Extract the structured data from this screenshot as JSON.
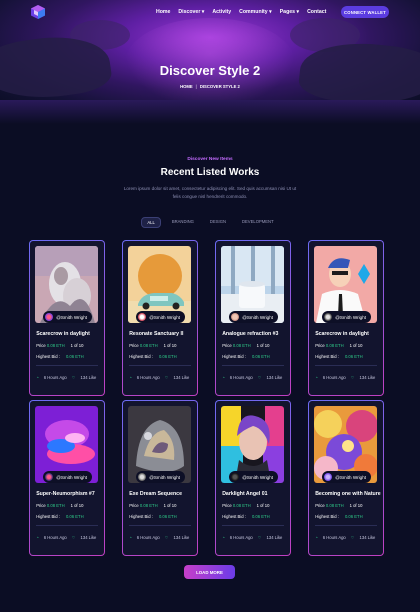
{
  "nav": {
    "links": [
      "Home",
      "Discover ▾",
      "Activity",
      "Community ▾",
      "Pages ▾",
      "Contact"
    ],
    "connect": "CONNECT WALLET"
  },
  "hero": {
    "title": "Discover Style 2",
    "breadcrumb": [
      "HOME",
      "DISCOVER STYLE 2"
    ]
  },
  "section": {
    "subtitle": "Discover New Items",
    "heading": "Recent Listed Works",
    "desc": "Lorem ipsum dolor sit amet, consectetur adipiscing elit. Sed quis accumsan nisi Ut ut felis congue nisl hendrerit commodo."
  },
  "filters": [
    "ALL",
    "BRANDING",
    "DESIGN",
    "DEVELOPMENT"
  ],
  "cards": [
    {
      "title": "Scarecrow in daylight",
      "owner": "@Smith Wright",
      "price_label": "Price",
      "price": "0.08 ETH",
      "qty": "1 of 10",
      "bid_label": "Highest Bid :",
      "bid": "0.06 ETH",
      "time": "6 Hours Ago",
      "likes": "134 Like"
    },
    {
      "title": "Resonate Sanctuary II",
      "owner": "@Smith Wright",
      "price_label": "Price",
      "price": "0.08 ETH",
      "qty": "1 of 10",
      "bid_label": "Highest Bid :",
      "bid": "0.06 ETH",
      "time": "6 Hours Ago",
      "likes": "134 Like"
    },
    {
      "title": "Analogue refraction #3",
      "owner": "@Smith Wright",
      "price_label": "Price",
      "price": "0.08 ETH",
      "qty": "1 of 10",
      "bid_label": "Highest Bid :",
      "bid": "0.06 ETH",
      "time": "6 Hours Ago",
      "likes": "134 Like"
    },
    {
      "title": "Scarecrow in daylight",
      "owner": "@Smith Wright",
      "price_label": "Price",
      "price": "0.08 ETH",
      "qty": "1 of 10",
      "bid_label": "Highest Bid :",
      "bid": "0.06 ETH",
      "time": "6 Hours Ago",
      "likes": "134 Like"
    },
    {
      "title": "Super-Neumorphism #7",
      "owner": "@Smith Wright",
      "price_label": "Price",
      "price": "0.08 ETH",
      "qty": "1 of 10",
      "bid_label": "Highest Bid :",
      "bid": "0.06 ETH",
      "time": "6 Hours Ago",
      "likes": "134 Like"
    },
    {
      "title": "Exe Dream Sequence",
      "owner": "@Smith Wright",
      "price_label": "Price",
      "price": "0.08 ETH",
      "qty": "1 of 10",
      "bid_label": "Highest Bid :",
      "bid": "0.06 ETH",
      "time": "6 Hours Ago",
      "likes": "134 Like"
    },
    {
      "title": "Darklight Angel 01",
      "owner": "@Smith Wright",
      "price_label": "Price",
      "price": "0.08 ETH",
      "qty": "1 of 10",
      "bid_label": "Highest Bid :",
      "bid": "0.06 ETH",
      "time": "6 Hours Ago",
      "likes": "134 Like"
    },
    {
      "title": "Becoming one with Nature",
      "owner": "@Smith Wright",
      "price_label": "Price",
      "price": "0.08 ETH",
      "qty": "1 of 10",
      "bid_label": "Highest Bid :",
      "bid": "0.06 ETH",
      "time": "6 Hours Ago",
      "likes": "134 Like"
    }
  ],
  "load_more": "LOAD MORE",
  "colors": {
    "accent": "#5b3ce0",
    "green": "#2fd18b",
    "pink": "#c46bff",
    "background": "#0b0d24"
  }
}
